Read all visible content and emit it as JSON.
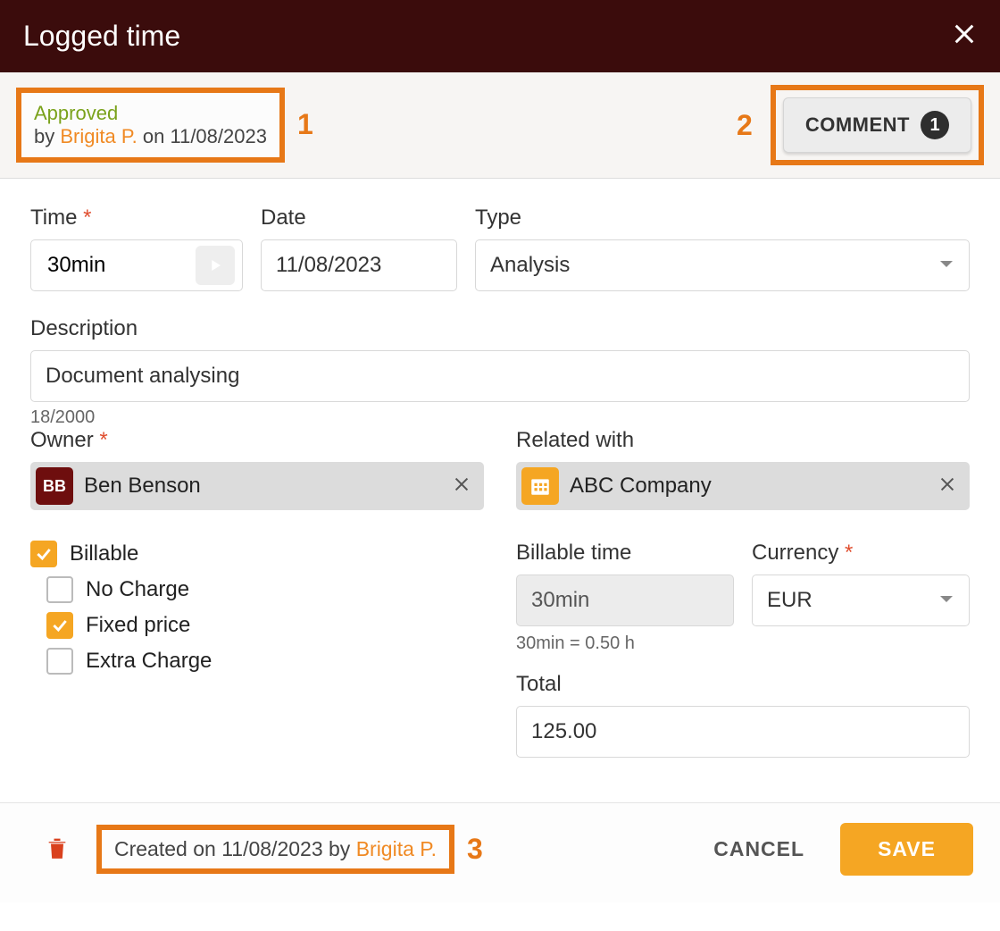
{
  "header": {
    "title": "Logged time"
  },
  "status": {
    "approved_label": "Approved",
    "by_prefix": "by ",
    "person": "Brigita P.",
    "on_prefix": " on ",
    "date": "11/08/2023"
  },
  "callouts": {
    "one": "1",
    "two": "2",
    "three": "3"
  },
  "comment": {
    "label": "COMMENT",
    "count": "1"
  },
  "form": {
    "time": {
      "label": "Time",
      "value": "30min"
    },
    "date": {
      "label": "Date",
      "value": "11/08/2023"
    },
    "type": {
      "label": "Type",
      "value": "Analysis"
    },
    "description": {
      "label": "Description",
      "value": "Document analysing",
      "counter": "18/2000"
    },
    "owner": {
      "label": "Owner",
      "initials": "BB",
      "name": "Ben Benson"
    },
    "related": {
      "label": "Related with",
      "name": "ABC Company"
    },
    "billable": {
      "label": "Billable",
      "no_charge": "No Charge",
      "fixed_price": "Fixed price",
      "extra_charge": "Extra Charge"
    },
    "billable_time": {
      "label": "Billable time",
      "value": "30min",
      "hint": "30min = 0.50 h"
    },
    "currency": {
      "label": "Currency",
      "value": "EUR"
    },
    "total": {
      "label": "Total",
      "value": "125.00"
    }
  },
  "footer": {
    "created_prefix": "Created on ",
    "created_date": "11/08/2023",
    "created_by_prefix": " by ",
    "created_person": "Brigita P.",
    "cancel": "CANCEL",
    "save": "SAVE"
  }
}
